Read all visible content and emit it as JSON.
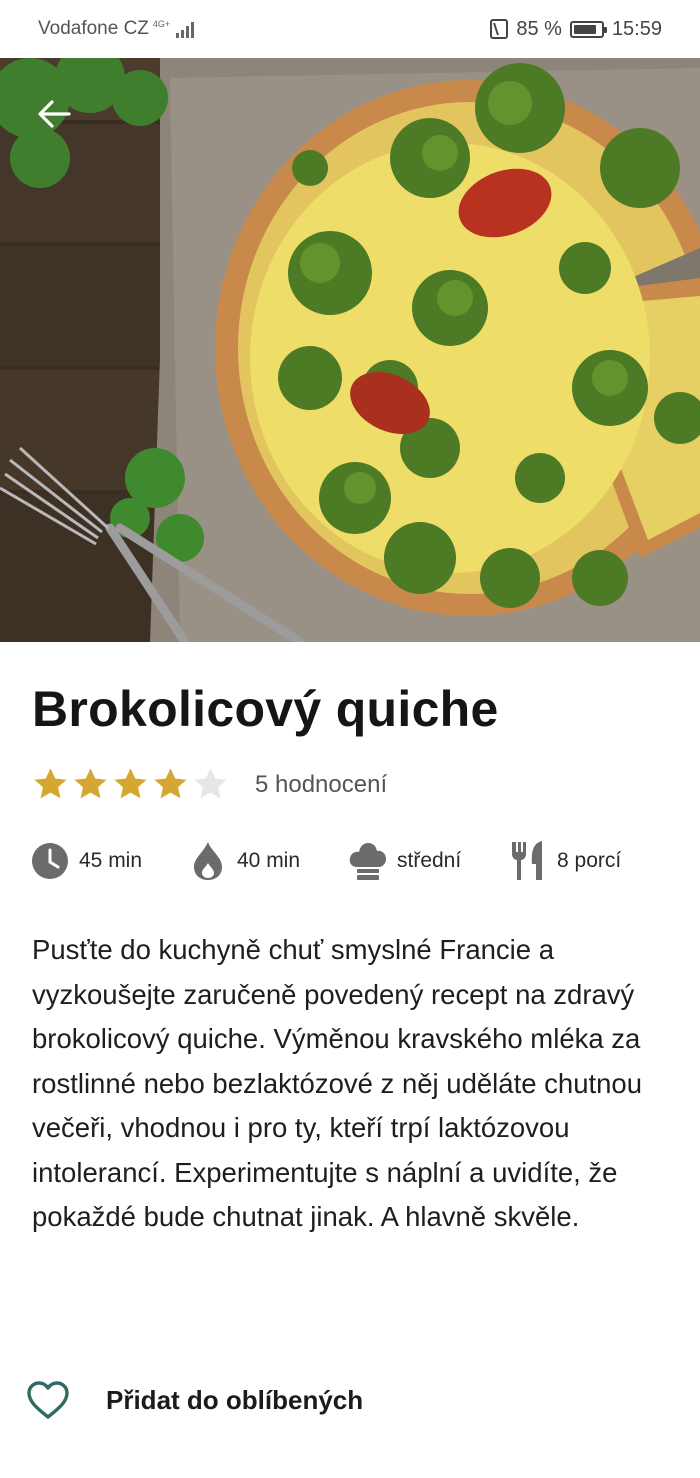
{
  "status_bar": {
    "carrier": "Vodafone CZ",
    "network": "4G+",
    "battery": "85 %",
    "time": "15:59"
  },
  "hero": {
    "back_icon": "arrow-left-icon"
  },
  "recipe": {
    "title": "Brokolicový quiche",
    "rating": 4,
    "rating_max": 5,
    "rating_count": "5 hodnocení",
    "star_color": "#d4a632",
    "star_empty_color": "#e6e6e6",
    "meta": {
      "prep_time": "45 min",
      "cook_time": "40 min",
      "difficulty": "střední",
      "servings": "8 porcí"
    },
    "description": "Pusťte do kuchyně chuť smyslné Francie a vyzkoušejte zaručeně povedený recept na zdravý brokolicový quiche. Výměnou kravského mléka za rostlinné nebo bezlaktózové z něj uděláte chutnou večeři, vhodnou i pro ty, kteří trpí laktózovou intolerancí. Experimentujte s náplní a uvidíte, že pokaždé bude chutnat jinak. A hlavně skvěle."
  },
  "favorite": {
    "label": "Přidat do oblíbených",
    "icon": "heart-outline-icon",
    "icon_color": "#2e6b63"
  }
}
